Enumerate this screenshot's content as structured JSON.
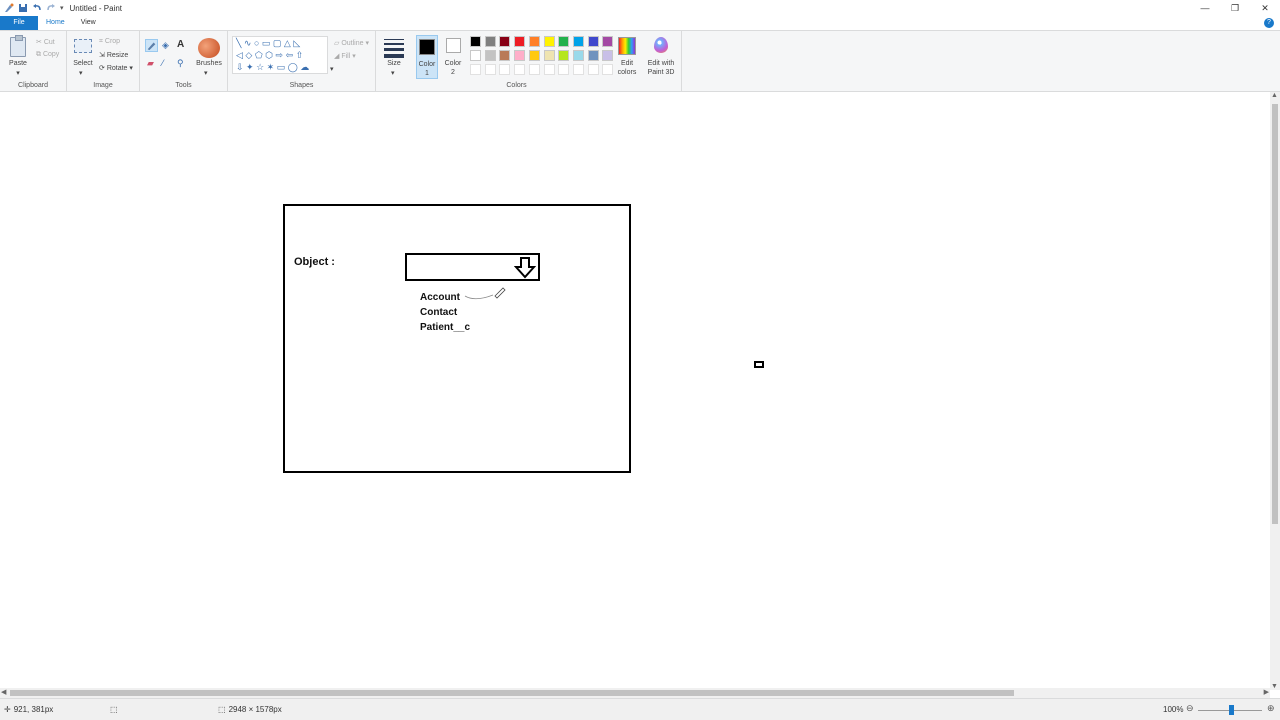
{
  "window": {
    "title": "Untitled - Paint"
  },
  "tabs": [
    "File",
    "Home",
    "View"
  ],
  "ribbon": {
    "clipboard": {
      "paste": "Paste",
      "cut": "Cut",
      "copy": "Copy",
      "label": "Clipboard"
    },
    "image": {
      "select": "Select",
      "crop": "Crop",
      "resize": "Resize",
      "rotate": "Rotate",
      "label": "Image"
    },
    "tools": {
      "brushes": "Brushes",
      "label": "Tools"
    },
    "shapes": {
      "outline": "Outline",
      "fill": "Fill",
      "label": "Shapes"
    },
    "size": "Size",
    "color1": "Color 1",
    "color2": "Color 2",
    "colors_label": "Colors",
    "edit_colors": "Edit colors",
    "edit_paint3d": "Edit with Paint 3D",
    "palette": [
      "#000000",
      "#7f7f7f",
      "#880015",
      "#ed1c24",
      "#ff7f27",
      "#fff200",
      "#22b14c",
      "#00a2e8",
      "#3f48cc",
      "#a349a4",
      "#ffffff",
      "#c3c3c3",
      "#b97a57",
      "#ffaec9",
      "#ffc90e",
      "#efe4b0",
      "#b5e61d",
      "#99d9ea",
      "#7092be",
      "#c8bfe7"
    ]
  },
  "canvas": {
    "object_label": "Object :",
    "options": [
      "Account",
      "Contact",
      "Patient__c"
    ]
  },
  "status": {
    "cursor": "921, 381px",
    "image_size": "2948 × 1578px",
    "zoom": "100%"
  }
}
